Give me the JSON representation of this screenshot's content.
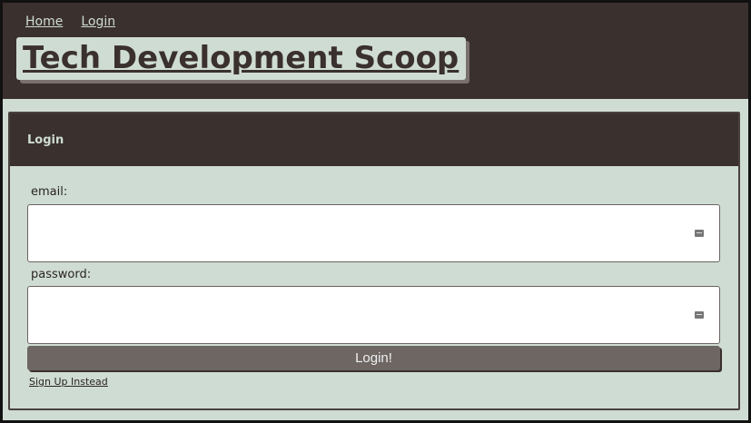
{
  "nav": {
    "home": "Home",
    "login": "Login"
  },
  "site": {
    "title": "Tech Development Scoop"
  },
  "card": {
    "header": "Login",
    "email_label": "email:",
    "password_label": "password:",
    "submit_label": "Login!",
    "signup_link": "Sign Up Instead"
  },
  "colors": {
    "header_bg": "#3a302e",
    "main_bg": "#cfdcd4",
    "button_bg": "#6d6663"
  }
}
